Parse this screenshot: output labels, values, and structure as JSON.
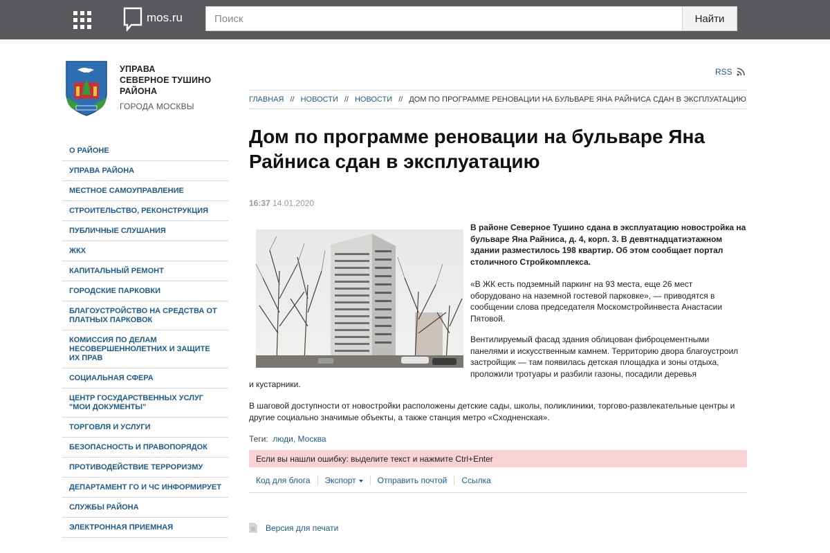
{
  "topbar": {
    "logo_text": "mos.ru",
    "search_placeholder": "Поиск",
    "search_button": "Найти"
  },
  "org": {
    "name_line1": "УПРАВА",
    "name_line2": "СЕВЕРНОЕ ТУШИНО",
    "name_line3": "РАЙОНА",
    "sub": "ГОРОДА МОСКВЫ"
  },
  "sidebar": {
    "items": [
      {
        "label": "О РАЙОНЕ"
      },
      {
        "label": "УПРАВА РАЙОНА"
      },
      {
        "label": "МЕСТНОЕ САМОУПРАВЛЕНИЕ"
      },
      {
        "label": "СТРОИТЕЛЬСТВО, РЕКОНСТРУКЦИЯ"
      },
      {
        "label": "ПУБЛИЧНЫЕ СЛУШАНИЯ"
      },
      {
        "label": "ЖКХ"
      },
      {
        "label": "КАПИТАЛЬНЫЙ РЕМОНТ"
      },
      {
        "label": "ГОРОДСКИЕ ПАРКОВКИ"
      },
      {
        "label": "БЛАГОУСТРОЙСТВО НА СРЕДСТВА ОТ ПЛАТНЫХ ПАРКОВОК"
      },
      {
        "label": "КОМИССИЯ ПО ДЕЛАМ НЕСОВЕРШЕННОЛЕТНИХ И ЗАЩИТЕ ИХ ПРАВ"
      },
      {
        "label": "СОЦИАЛЬНАЯ СФЕРА"
      },
      {
        "label": "ЦЕНТР ГОСУДАРСТВЕННЫХ УСЛУГ \"МОИ ДОКУМЕНТЫ\""
      },
      {
        "label": "ТОРГОВЛЯ И УСЛУГИ"
      },
      {
        "label": "БЕЗОПАСНОСТЬ И ПРАВОПОРЯДОК"
      },
      {
        "label": "ПРОТИВОДЕЙСТВИЕ ТЕРРОРИЗМУ"
      },
      {
        "label": "ДЕПАРТАМЕНТ ГО И ЧС ИНФОРМИРУЕТ"
      },
      {
        "label": "СЛУЖБЫ РАЙОНА"
      },
      {
        "label": "ЭЛЕКТРОННАЯ ПРИЕМНАЯ"
      }
    ]
  },
  "rss_label": "RSS",
  "breadcrumb": {
    "items": [
      "ГЛАВНАЯ",
      "НОВОСТИ",
      "НОВОСТИ"
    ],
    "separator": "//",
    "current": "ДОМ ПО ПРОГРАММЕ РЕНОВАЦИИ НА БУЛЬВАРЕ ЯНА РАЙНИСА СДАН В ЭКСПЛУАТАЦИЮ"
  },
  "article": {
    "title": "Дом по программе реновации на бульваре Яна Райниса сдан в эксплуатацию",
    "time": "16:37",
    "date": "14.01.2020",
    "lead": "В районе Северное Тушино сдана в эксплуатацию новостройка на бульваре Яна Райниса, д. 4, корп. 3. В девятнадцатиэтажном здании разместилось 198 квартир. Об этом сообщает портал столичного Стройкомплекса.",
    "para1": "«В ЖК есть подземный паркинг на 93 места, еще 26 мест оборудовано на наземной гостевой парковке», — приводятся в сообщении слова председателя Москомстройинвеста Анастасии Пятовой.",
    "para2a": "Вентилируемый фасад здания облицован фиброцементными панелями и искусственным камнем. Территорию двора благоустроил застройщик — там появилась детская площадка и зоны отдыха, проложили тротуары и разбили газоны, посадили деревья",
    "para2b": "и кустарники.",
    "para3": "В шаговой доступности от новостройки расположены детские сады, школы, поликлиники, торгово-развлекательные центры и другие социально значимые объекты, а также станция метро «Сходненская»."
  },
  "tags": {
    "label": "Теги:",
    "items": [
      "люди",
      "Москва"
    ]
  },
  "error_notice": "Если вы нашли ошибку: выделите текст и нажмите Ctrl+Enter",
  "actions": {
    "blog_code": "Код для блога",
    "export": "Экспорт",
    "send_mail": "Отправить почтой",
    "link": "Ссылка"
  },
  "print_version": "Версия для печати"
}
